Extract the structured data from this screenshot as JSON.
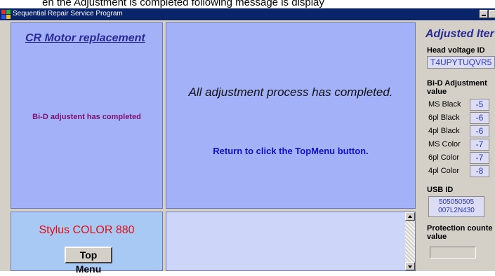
{
  "caption": "en the Adjustment is completed following message is display",
  "window": {
    "title": "Sequential Repair Service Program"
  },
  "motor_panel": {
    "title": "CR Motor replacement",
    "message": "Bi-D adjustent has completed"
  },
  "main_panel": {
    "message": "All adjustment process has completed.",
    "instruction": "Return to click the TopMenu button."
  },
  "model_panel": {
    "model": "Stylus COLOR 880",
    "top_menu_label": "Top Menu"
  },
  "adjusted_items": {
    "title": "Adjusted Iter",
    "head_voltage_label": "Head voltage ID",
    "head_voltage_value": "T4UPYTUQVR5",
    "bid_label_1": "Bi-D Adjustment",
    "bid_label_2": "value",
    "rows": [
      {
        "label": "MS Black",
        "value": "-5"
      },
      {
        "label": "6pl Black",
        "value": "-6"
      },
      {
        "label": "4pl Black",
        "value": "-6"
      },
      {
        "label": "MS Color",
        "value": "-7"
      },
      {
        "label": "6pl Color",
        "value": "-7"
      },
      {
        "label": "4pl Color",
        "value": "-8"
      }
    ],
    "usb_label": "USB ID",
    "usb_value_1": "505050505",
    "usb_value_2": "007L2N430",
    "protection_label_1": "Protection counte",
    "protection_label_2": "value",
    "protection_value": ""
  },
  "colors": {
    "titlebar": "#0a246a",
    "panel_blue": "#a3b2f8",
    "panel_light": "#a9c9f5",
    "accent_red": "#e01010",
    "accent_navy": "#2a2a95"
  }
}
